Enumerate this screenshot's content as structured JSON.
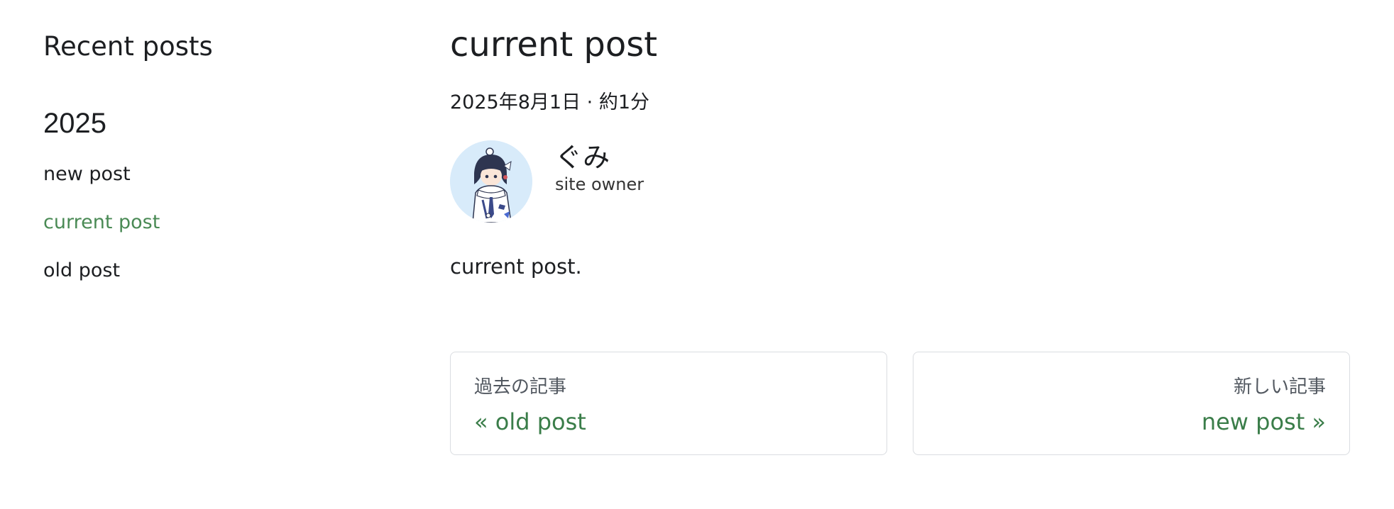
{
  "sidebar": {
    "title": "Recent posts",
    "year": "2025",
    "items": [
      {
        "label": "new post",
        "active": false
      },
      {
        "label": "current post",
        "active": true
      },
      {
        "label": "old post",
        "active": false
      }
    ]
  },
  "post": {
    "title": "current post",
    "meta": "2025年8月1日 · 約1分",
    "author": {
      "name": "ぐみ",
      "title": "site owner"
    },
    "body": "current post."
  },
  "pager": {
    "prev": {
      "sub": "過去の記事",
      "label": "« old post"
    },
    "next": {
      "sub": "新しい記事",
      "label": "new post »"
    }
  },
  "colors": {
    "accent": "#3a7d49",
    "active_link": "#4a8a55",
    "avatar_bg": "#d8ebfa",
    "border": "#dadde1"
  }
}
